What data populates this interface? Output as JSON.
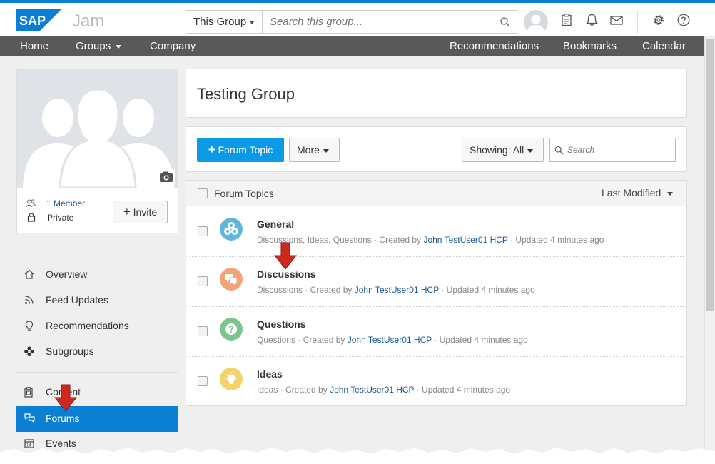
{
  "header": {
    "brand": "SAP",
    "product": "Jam",
    "scope_label": "This Group",
    "search_placeholder": "Search this group...",
    "icons": [
      "user-avatar",
      "clipboard-icon",
      "bell-icon",
      "mail-icon",
      "gear-icon",
      "help-icon"
    ]
  },
  "nav": {
    "left": [
      {
        "label": "Home"
      },
      {
        "label": "Groups",
        "has_menu": true
      },
      {
        "label": "Company"
      }
    ],
    "right": [
      {
        "label": "Recommendations"
      },
      {
        "label": "Bookmarks"
      },
      {
        "label": "Calendar"
      }
    ]
  },
  "group_card": {
    "members": "1 Member",
    "privacy": "Private",
    "invite_label": "Invite"
  },
  "sidebar": {
    "items": [
      {
        "label": "Overview",
        "icon": "home-icon"
      },
      {
        "label": "Feed Updates",
        "icon": "rss-icon"
      },
      {
        "label": "Recommendations",
        "icon": "lightbulb-icon"
      },
      {
        "label": "Subgroups",
        "icon": "subgroups-icon"
      },
      {
        "label": "Content",
        "icon": "content-icon"
      },
      {
        "label": "Forums",
        "icon": "forums-icon",
        "active": true
      },
      {
        "label": "Events",
        "icon": "calendar-icon"
      }
    ]
  },
  "page": {
    "title": "Testing Group"
  },
  "toolbar": {
    "new_topic_label": "Forum Topic",
    "more_label": "More",
    "showing_label": "Showing:",
    "showing_value": "All",
    "search_placeholder": "Search"
  },
  "list": {
    "header_label": "Forum Topics",
    "sort_label": "Last Modified",
    "rows": [
      {
        "title": "General",
        "prefix": "Discussions, Ideas, Questions · Created by ",
        "author": "John TestUser01 HCP",
        "suffix": " · Updated 4 minutes ago",
        "icon": "general-forum-icon",
        "color": "#5fb7e0"
      },
      {
        "title": "Discussions",
        "prefix": "Discussions · Created by ",
        "author": "John TestUser01 HCP",
        "suffix": " · Updated 4 minutes ago",
        "icon": "discussions-icon",
        "color": "#f3a477"
      },
      {
        "title": "Questions",
        "prefix": "Questions · Created by ",
        "author": "John TestUser01 HCP",
        "suffix": " · Updated 4 minutes ago",
        "icon": "questions-icon",
        "color": "#7ec48f"
      },
      {
        "title": "Ideas",
        "prefix": "Ideas · Created by ",
        "author": "John TestUser01 HCP",
        "suffix": " · Updated 4 minutes ago",
        "icon": "ideas-icon",
        "color": "#f4d36b"
      }
    ]
  },
  "colors": {
    "accent": "#0a7fd4",
    "primary_button": "#0a9ae6",
    "nav_bg": "#595959",
    "link": "#1a5a96",
    "annotation_arrow": "#cc2a1e"
  }
}
